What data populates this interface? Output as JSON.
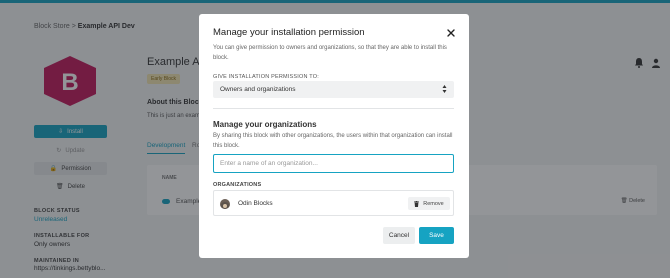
{
  "background": {
    "breadcrumb": {
      "root": "Block Store",
      "separator": ">",
      "current": "Example API Dev"
    },
    "logo_letter": "B",
    "sidebar": {
      "install_label": "Install",
      "update_label": "Update",
      "permission_label": "Permission",
      "delete_label": "Delete",
      "block_status_label": "BLOCK STATUS",
      "block_status_value": "Unreleased",
      "installable_for_label": "INSTALLABLE FOR",
      "installable_for_value": "Only owners",
      "maintained_in_label": "MAINTAINED IN",
      "maintained_in_value": "https://tinkings.bettyblo..."
    },
    "main": {
      "title": "Example API",
      "tag": "Early Block",
      "about_heading": "About this Block",
      "about_text": "This is just an exam...",
      "tab_active": "Development",
      "tab_other": "Ro...",
      "table_header": "NAME",
      "table_row_name": "Example...",
      "table_row_action": "Delete"
    }
  },
  "modal": {
    "title": "Manage your installation permission",
    "description": "You can give permission to owners and organizations, so that they are able to install this block.",
    "permission_label": "GIVE INSTALLATION PERMISSION TO:",
    "permission_selected": "Owners and organizations",
    "orgs_heading": "Manage your organizations",
    "orgs_description": "By sharing this block with other organizations, the users within that organization can install this block.",
    "org_input_placeholder": "Enter a name of an organization...",
    "org_input_value": "",
    "organizations_label": "ORGANIZATIONS",
    "organizations": [
      {
        "name": "Odin Blocks",
        "action": "Remove"
      }
    ],
    "cancel_label": "Cancel",
    "save_label": "Save"
  },
  "colors": {
    "accent": "#16a3c2",
    "logo": "#c2185b"
  }
}
